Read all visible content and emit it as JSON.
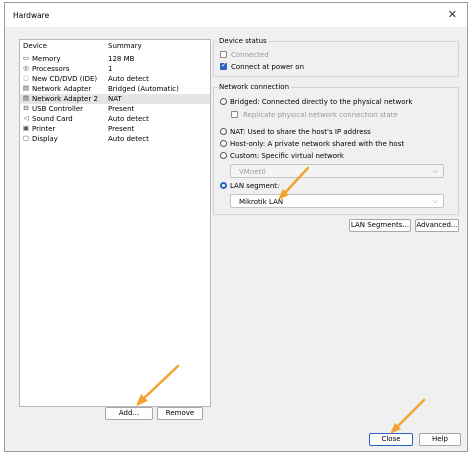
{
  "window": {
    "title": "Hardware",
    "close_glyph": "✕"
  },
  "device_list": {
    "col_device": "Device",
    "col_summary": "Summary",
    "rows": [
      {
        "name": "Memory",
        "summary": "128 MB",
        "icon": "memory-icon",
        "glyph": "▭"
      },
      {
        "name": "Processors",
        "summary": "1",
        "icon": "processor-icon",
        "glyph": "◎"
      },
      {
        "name": "New CD/DVD (IDE)",
        "summary": "Auto detect",
        "icon": "cd-dvd-icon",
        "glyph": "◌"
      },
      {
        "name": "Network Adapter",
        "summary": "Bridged (Automatic)",
        "icon": "network-adapter-icon",
        "glyph": "▤"
      },
      {
        "name": "Network Adapter 2",
        "summary": "NAT",
        "icon": "network-adapter-icon",
        "glyph": "▤",
        "selected": true
      },
      {
        "name": "USB Controller",
        "summary": "Present",
        "icon": "usb-icon",
        "glyph": "⊟"
      },
      {
        "name": "Sound Card",
        "summary": "Auto detect",
        "icon": "speaker-icon",
        "glyph": "◁"
      },
      {
        "name": "Printer",
        "summary": "Present",
        "icon": "printer-icon",
        "glyph": "▣"
      },
      {
        "name": "Display",
        "summary": "Auto detect",
        "icon": "display-icon",
        "glyph": "▢"
      }
    ],
    "add_label": "Add...",
    "remove_label": "Remove"
  },
  "device_status": {
    "label": "Device status",
    "connected": "Connected",
    "connected_checked": false,
    "connect_at_power_on": "Connect at power on",
    "connect_at_power_on_checked": true
  },
  "network_connection": {
    "label": "Network connection",
    "bridged": "Bridged: Connected directly to the physical network",
    "replicate": "Replicate physical network connection state",
    "nat": "NAT: Used to share the host's IP address",
    "host_only": "Host-only: A private network shared with the host",
    "custom": "Custom: Specific virtual network",
    "custom_value": "VMnet0",
    "lan_segment": "LAN segment:",
    "lan_segment_value": "Mikrotik LAN",
    "selected": "lan_segment"
  },
  "buttons": {
    "lan_segments": "LAN Segments...",
    "advanced": "Advanced...",
    "close": "Close",
    "help": "Help"
  },
  "colors": {
    "accent": "#2a63c8",
    "arrow": "#f4a330"
  }
}
